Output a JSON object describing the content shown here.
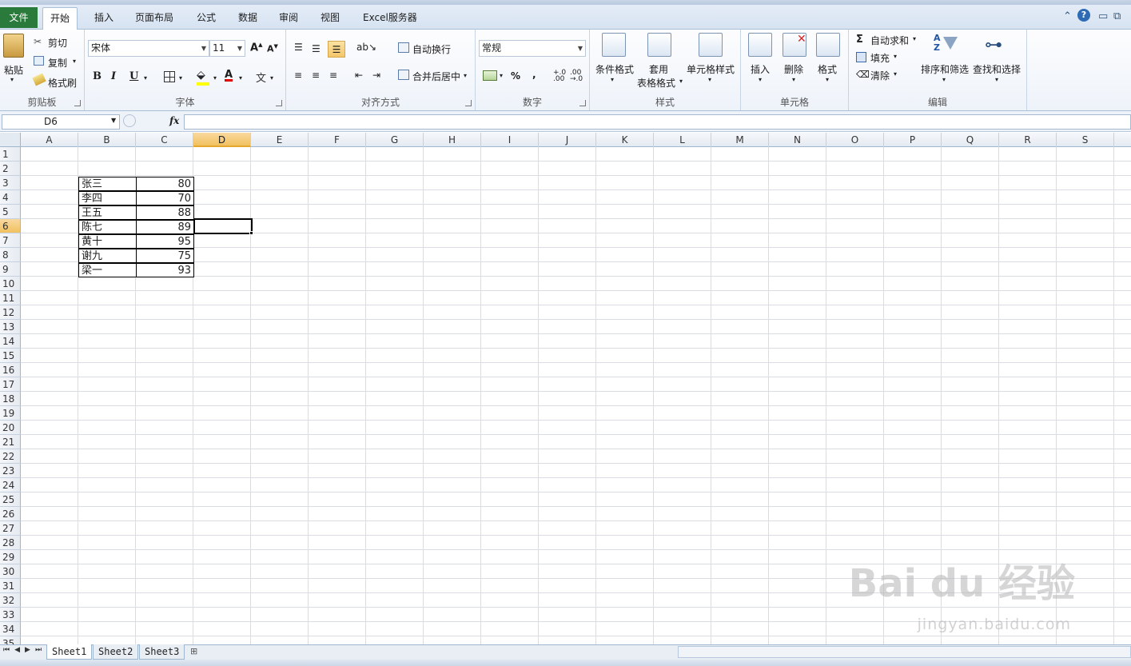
{
  "ribbon_tabs": [
    "文件",
    "开始",
    "插入",
    "页面布局",
    "公式",
    "数据",
    "审阅",
    "视图",
    "Excel服务器"
  ],
  "active_tab": "开始",
  "clipboard": {
    "paste": "粘贴",
    "cut": "剪切",
    "copy": "复制",
    "format_painter": "格式刷",
    "group": "剪贴板"
  },
  "font": {
    "name": "宋体",
    "size": "11",
    "group": "字体",
    "bold": "B",
    "italic": "I",
    "underline": "U"
  },
  "alignment": {
    "wrap": "自动换行",
    "merge": "合并后居中",
    "group": "对齐方式"
  },
  "number": {
    "format": "常规",
    "percent": "%",
    "comma": ",",
    "group": "数字"
  },
  "styles": {
    "conditional": "条件格式",
    "table_line1": "套用",
    "table_line2": "表格格式",
    "cell_styles": "单元格样式",
    "group": "样式"
  },
  "cells": {
    "insert": "插入",
    "delete": "删除",
    "format": "格式",
    "group": "单元格"
  },
  "editing": {
    "autosum": "自动求和",
    "fill": "填充",
    "clear": "清除",
    "sort": "排序和筛选",
    "find": "查找和选择",
    "group": "编辑"
  },
  "formula_bar": {
    "name_box": "D6",
    "fx": "fx",
    "value": ""
  },
  "columns": [
    "A",
    "B",
    "C",
    "D",
    "E",
    "F",
    "G",
    "H",
    "I",
    "J",
    "K",
    "L",
    "M",
    "N",
    "O",
    "P",
    "Q",
    "R",
    "S"
  ],
  "selected_column": "D",
  "rows": [
    "1",
    "2",
    "3",
    "4",
    "5",
    "6",
    "7",
    "8",
    "9",
    "10",
    "11",
    "12",
    "13",
    "14",
    "15",
    "16",
    "17",
    "18",
    "19",
    "20",
    "21",
    "22",
    "23",
    "24",
    "25",
    "26",
    "27",
    "28",
    "29",
    "30",
    "31",
    "32",
    "33",
    "34",
    "35"
  ],
  "selected_row": "6",
  "table": [
    {
      "name": "张三",
      "score": "80"
    },
    {
      "name": "李四",
      "score": "70"
    },
    {
      "name": "王五",
      "score": "88"
    },
    {
      "name": "陈七",
      "score": "89"
    },
    {
      "name": "黄十",
      "score": "95"
    },
    {
      "name": "谢九",
      "score": "75"
    },
    {
      "name": "梁一",
      "score": "93"
    }
  ],
  "sheets": [
    "Sheet1",
    "Sheet2",
    "Sheet3"
  ],
  "active_sheet": "Sheet1",
  "watermark": {
    "brand": "Bai du 经验",
    "url": "jingyan.baidu.com"
  }
}
